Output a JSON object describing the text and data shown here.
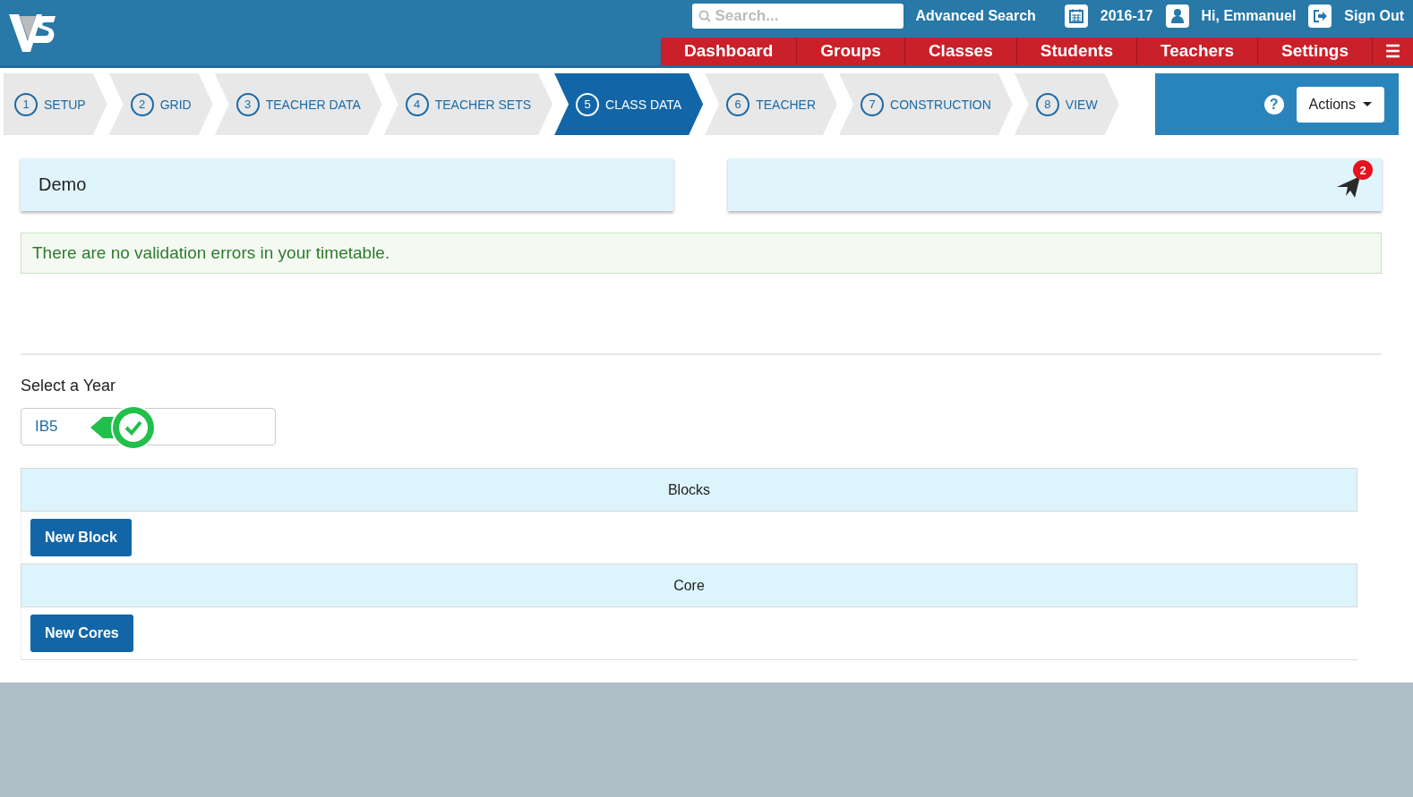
{
  "header": {
    "search_placeholder": "Search...",
    "advanced_search": "Advanced Search",
    "year": "2016-17",
    "user": "Hi, Emmanuel",
    "sign_out": "Sign Out"
  },
  "nav": [
    "Dashboard",
    "Groups",
    "Classes",
    "Students",
    "Teachers",
    "Settings"
  ],
  "menu_icon": "☰",
  "steps": [
    {
      "number": "1",
      "label": "SETUP",
      "selected": false
    },
    {
      "number": "2",
      "label": "GRID",
      "selected": false
    },
    {
      "number": "3",
      "label": "TEACHER DATA",
      "selected": false
    },
    {
      "number": "4",
      "label": "TEACHER SETS",
      "selected": false
    },
    {
      "number": "5",
      "label": "CLASS DATA",
      "selected": true
    },
    {
      "number": "6",
      "label": "TEACHER",
      "selected": false
    },
    {
      "number": "7",
      "label": "CONSTRUCTION",
      "selected": false
    },
    {
      "number": "8",
      "label": "VIEW",
      "selected": false
    }
  ],
  "actions": {
    "help": "?",
    "label": "Actions"
  },
  "project": "Demo",
  "notifications": {
    "count": "2"
  },
  "validation": "There are no validation errors in your timetable.",
  "year_select": {
    "label": "Select a Year",
    "value": "IB5",
    "valid": true
  },
  "sections": [
    {
      "title": "Blocks",
      "button": "New Block"
    },
    {
      "title": "Core",
      "button": "New Cores"
    }
  ]
}
